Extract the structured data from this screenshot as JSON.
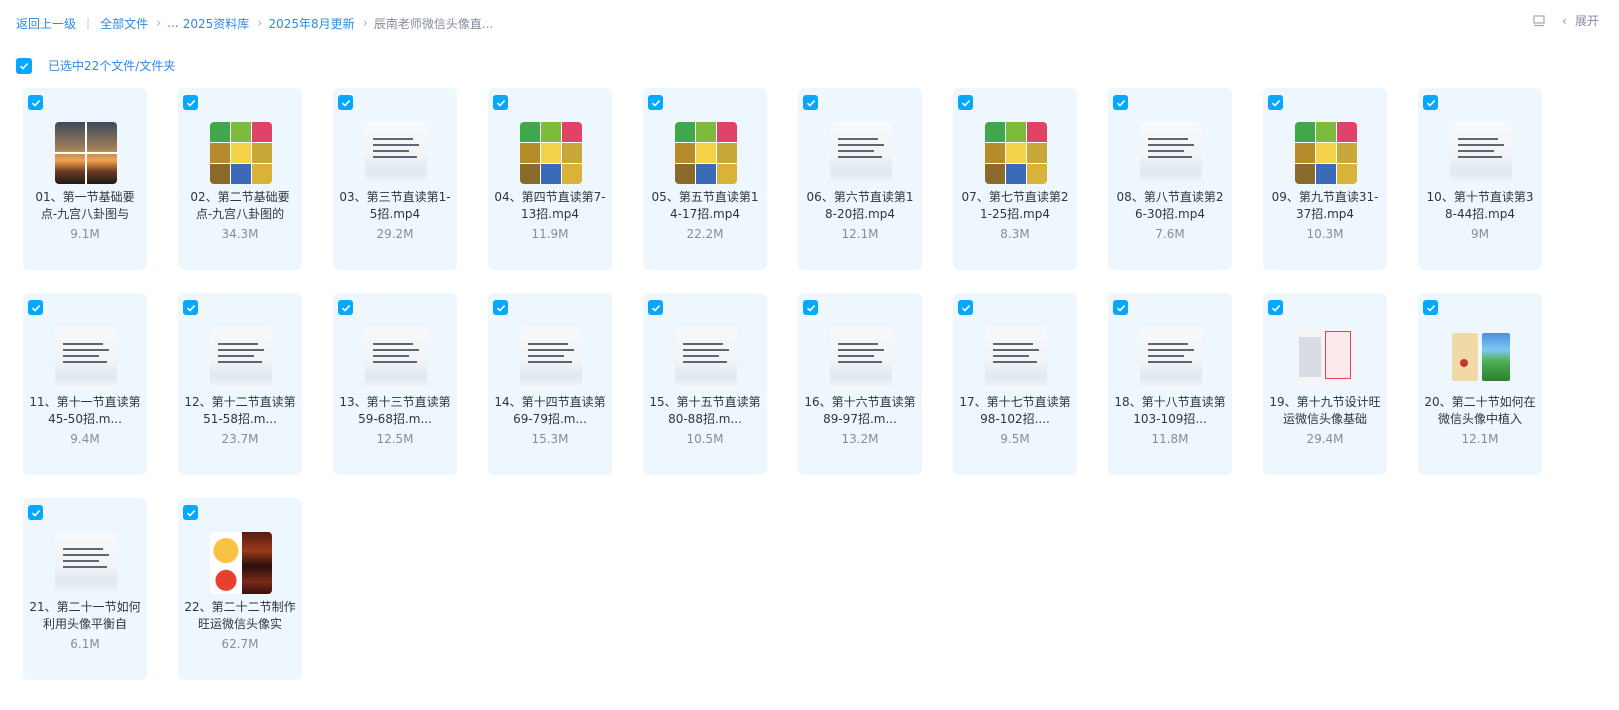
{
  "breadcrumb": {
    "back_label": "返回上一级",
    "separator": "|",
    "all_files_label": "全部文件",
    "ellipsis": "...",
    "items": [
      "2025资料库",
      "2025年8月更新",
      "辰南老师微信头像直..."
    ]
  },
  "toolbar": {
    "expand_label": "展开"
  },
  "selection": {
    "text": "已选中22个文件/文件夹"
  },
  "colors": {
    "accent": "#06a7ff",
    "link": "#2c8be6",
    "card_bg": "#eef7fd"
  },
  "files": [
    {
      "name": "01、第一节基础要点-九宫八卦图与",
      "size": "9.1M",
      "thumb": "photo"
    },
    {
      "name": "02、第二节基础要点-九宫八卦图的",
      "size": "34.3M",
      "thumb": "bagua"
    },
    {
      "name": "03、第三节直读第1-5招.mp4",
      "size": "29.2M",
      "thumb": "doc"
    },
    {
      "name": "04、第四节直读第7-13招.mp4",
      "size": "11.9M",
      "thumb": "bagua"
    },
    {
      "name": "05、第五节直读第14-17招.mp4",
      "size": "22.2M",
      "thumb": "bagua"
    },
    {
      "name": "06、第六节直读第18-20招.mp4",
      "size": "12.1M",
      "thumb": "doc"
    },
    {
      "name": "07、第七节直读第21-25招.mp4",
      "size": "8.3M",
      "thumb": "bagua"
    },
    {
      "name": "08、第八节直读第26-30招.mp4",
      "size": "7.6M",
      "thumb": "doc"
    },
    {
      "name": "09、第九节直读31-37招.mp4",
      "size": "10.3M",
      "thumb": "bagua"
    },
    {
      "name": "10、第十节直读第38-44招.mp4",
      "size": "9M",
      "thumb": "doc"
    },
    {
      "name": "11、第十一节直读第45-50招.m...",
      "size": "9.4M",
      "thumb": "doc"
    },
    {
      "name": "12、第十二节直读第51-58招.m...",
      "size": "23.7M",
      "thumb": "doc"
    },
    {
      "name": "13、第十三节直读第59-68招.m...",
      "size": "12.5M",
      "thumb": "doc"
    },
    {
      "name": "14、第十四节直读第69-79招.m...",
      "size": "15.3M",
      "thumb": "doc"
    },
    {
      "name": "15、第十五节直读第80-88招.m...",
      "size": "10.5M",
      "thumb": "doc"
    },
    {
      "name": "16、第十六节直读第89-97招.m...",
      "size": "13.2M",
      "thumb": "doc"
    },
    {
      "name": "17、第十七节直读第98-102招....",
      "size": "9.5M",
      "thumb": "doc"
    },
    {
      "name": "18、第十八节直读第103-109招...",
      "size": "11.8M",
      "thumb": "doc"
    },
    {
      "name": "19、第十九节设计旺运微信头像基础",
      "size": "29.4M",
      "thumb": "mix"
    },
    {
      "name": "20、第二十节如何在微信头像中植入",
      "size": "12.1M",
      "thumb": "nature"
    },
    {
      "name": "21、第二十一节如何利用头像平衡自",
      "size": "6.1M",
      "thumb": "doc"
    },
    {
      "name": "22、第二十二节制作旺运微信头像实",
      "size": "62.7M",
      "thumb": "gold"
    }
  ]
}
